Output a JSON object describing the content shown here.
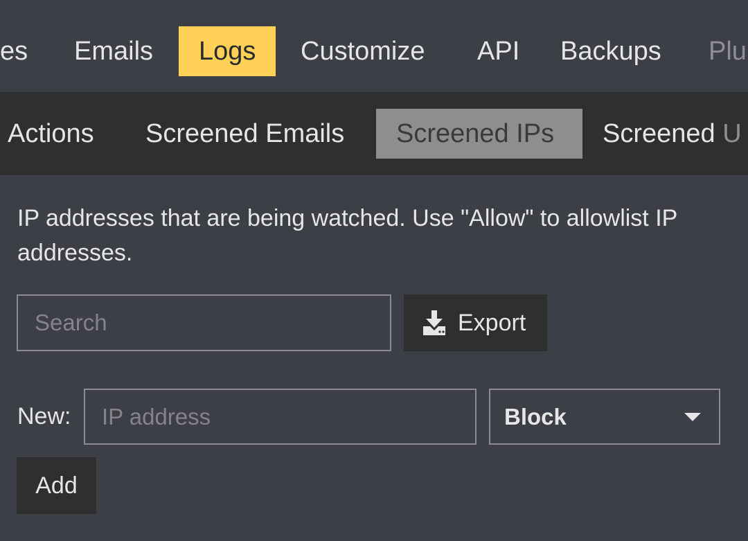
{
  "top_nav": {
    "tabs": [
      {
        "label": "es"
      },
      {
        "label": "Emails"
      },
      {
        "label": "Logs"
      },
      {
        "label": "Customize"
      },
      {
        "label": "API"
      },
      {
        "label": "Backups"
      },
      {
        "label": "Plu"
      }
    ],
    "active_color": "#ffd257"
  },
  "sub_nav": {
    "tabs": [
      {
        "label": "Actions"
      },
      {
        "label": "Screened Emails"
      },
      {
        "label": "Screened IPs"
      },
      {
        "label": "Screened ",
        "label_faded": "U"
      }
    ]
  },
  "description": "IP addresses that are being watched. Use \"Allow\" to allowlist IP addresses.",
  "search": {
    "placeholder": "Search",
    "value": ""
  },
  "export": {
    "label": "Export",
    "icon": "download-icon"
  },
  "new_entry": {
    "label": "New:",
    "ip_placeholder": "IP address",
    "action_selected": "Block",
    "add_label": "Add"
  }
}
